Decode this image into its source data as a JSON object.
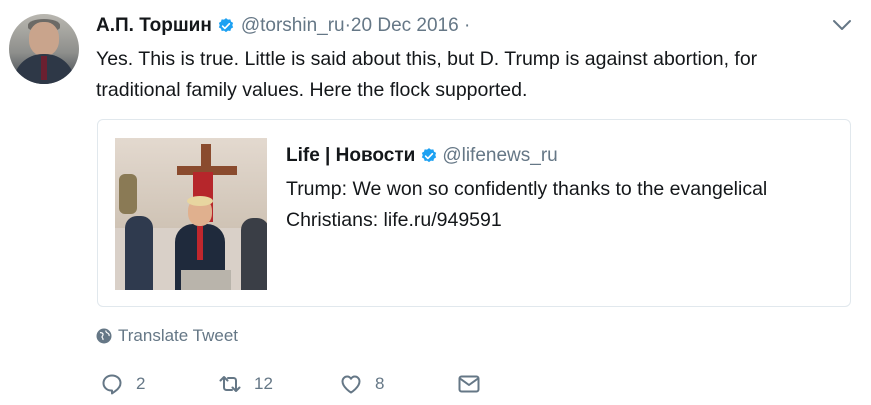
{
  "tweet": {
    "author_name": "А.П. Торшин",
    "handle": "@torshin_ru",
    "date": "·20 Dec 2016 ·",
    "text": "Yes. This is true. Little is said about this, but D. Trump is against abortion, for traditional family values. Here the flock supported."
  },
  "quoted": {
    "author_name": "Life | Новости",
    "handle": "@lifenews_ru",
    "text": "Trump: We won so confidently thanks to the evangelical Christians: life.ru/949591"
  },
  "translate_label": "Translate Tweet",
  "actions": {
    "reply_count": "2",
    "retweet_count": "12",
    "like_count": "8"
  },
  "icons": {
    "verified": "verified-badge-icon",
    "menu": "chevron-down-icon",
    "translate": "globe-icon",
    "reply": "reply-icon",
    "retweet": "retweet-icon",
    "like": "heart-icon",
    "message": "envelope-icon"
  },
  "colors": {
    "verified_blue": "#1da1f2",
    "secondary_text": "#657786",
    "border": "#e1e8ed"
  }
}
